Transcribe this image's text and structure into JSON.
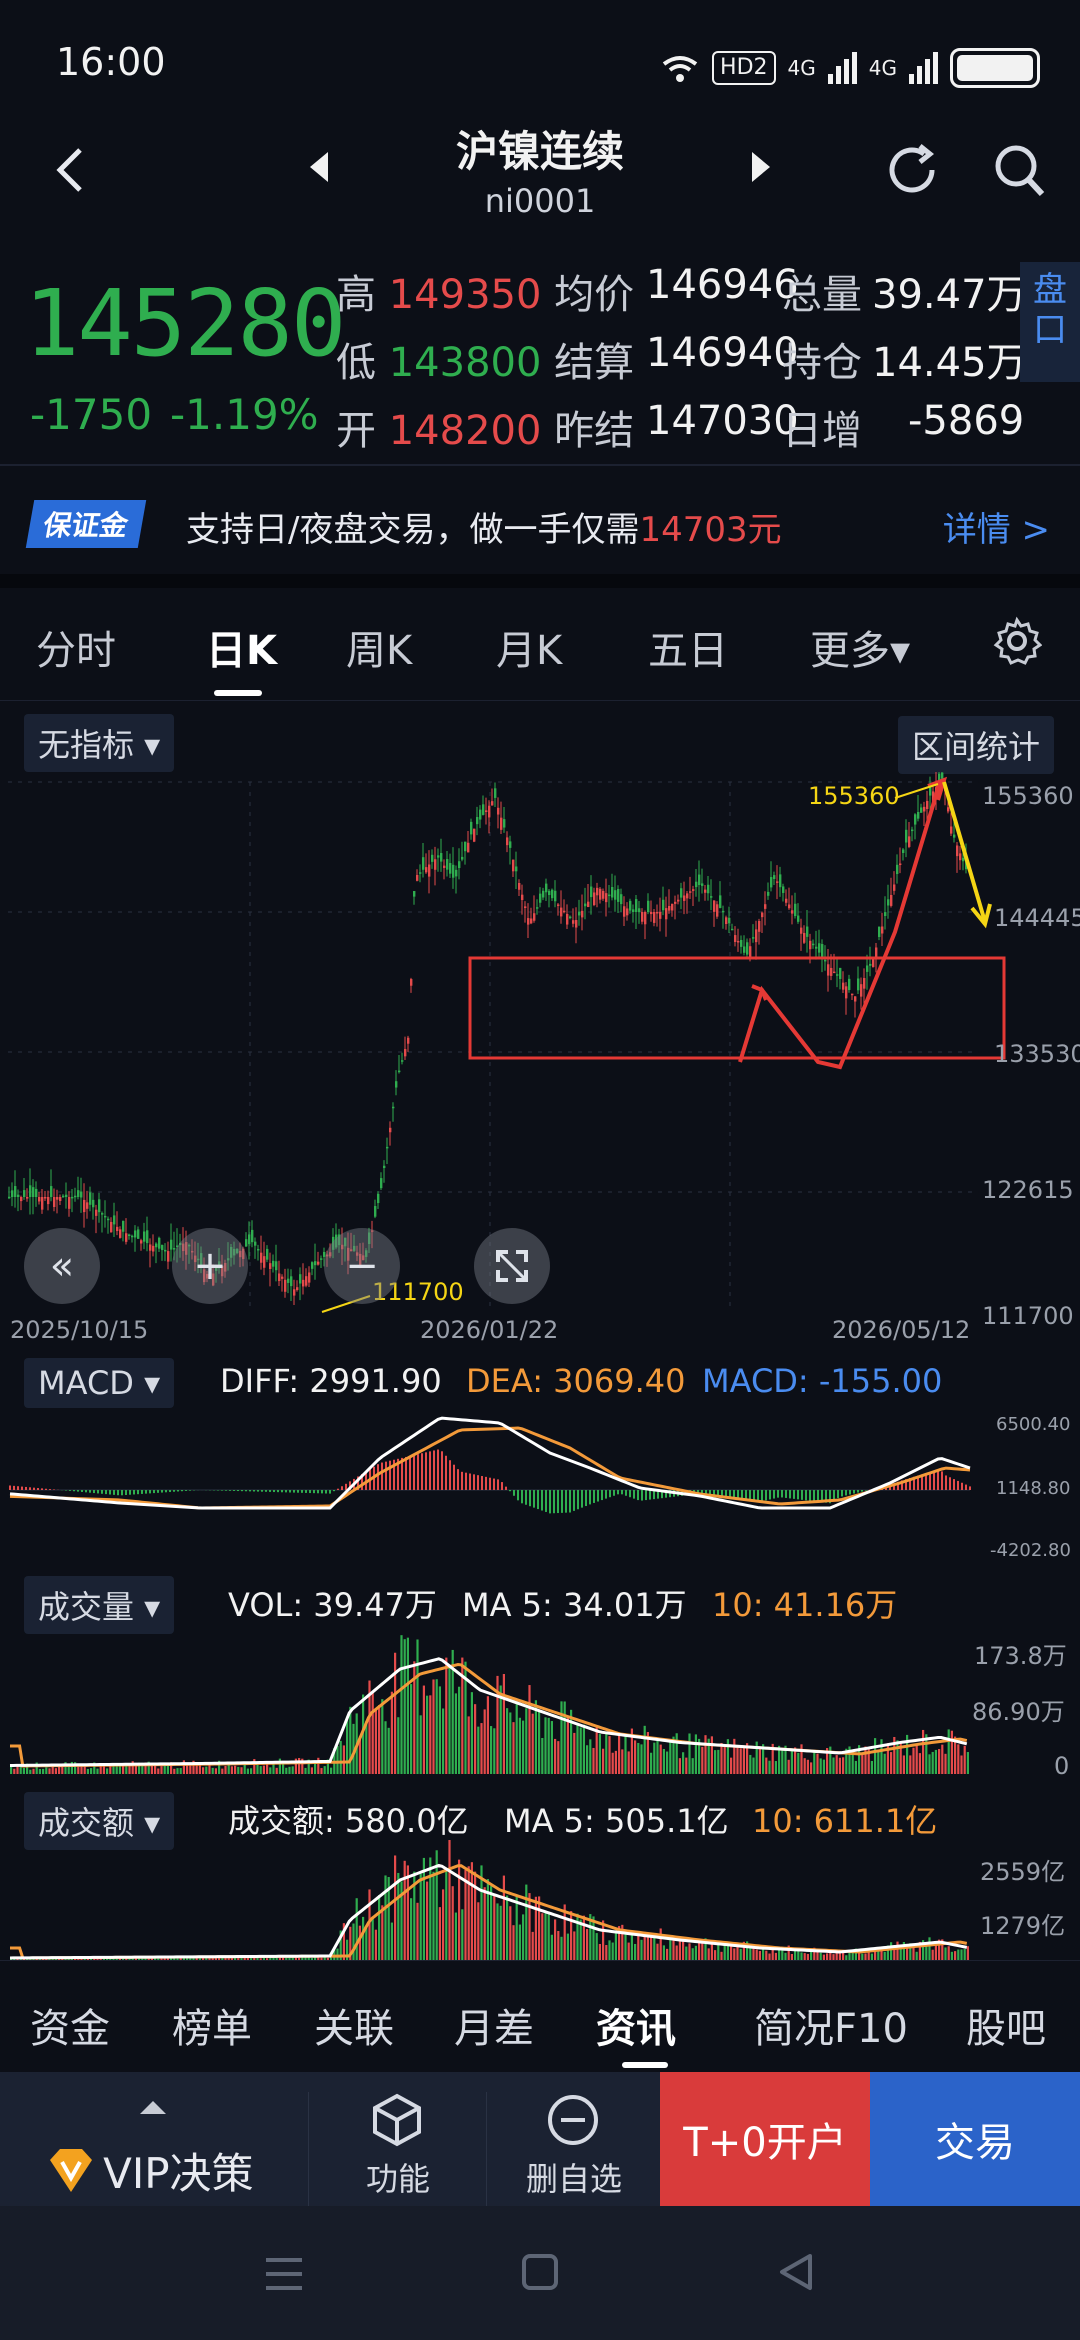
{
  "status": {
    "time": "16:00",
    "hd": "HD2",
    "net1": "4G",
    "net2": "4G"
  },
  "header": {
    "title": "沪镍连续",
    "code": "ni0001"
  },
  "quote": {
    "last": "145280",
    "change": "-1750",
    "change_pct": "-1.19%",
    "rows": [
      {
        "l1": "高",
        "v1": "149350",
        "l2": "均价",
        "v2": "146946",
        "l3": "总量",
        "v3": "39.47万"
      },
      {
        "l1": "低",
        "v1": "143800",
        "l2": "结算",
        "v2": "146940",
        "l3": "持仓",
        "v3": "14.45万"
      },
      {
        "l1": "开",
        "v1": "148200",
        "l2": "昨结",
        "v2": "147030",
        "l3": "日增",
        "v3": "-5869"
      }
    ],
    "panel_button": "盘口"
  },
  "banner": {
    "badge": "保证金",
    "text": "支持日/夜盘交易，做一手仅需",
    "amount": "14703元",
    "detail": "详情 >"
  },
  "tabs": [
    "分时",
    "日K",
    "周K",
    "月K",
    "五日",
    "更多▾"
  ],
  "chart": {
    "indicator_selector": "无指标 ▾",
    "range_stats": "区间统计",
    "y_labels": [
      "155360",
      "144445",
      "133530",
      "122615",
      "111700"
    ],
    "x_labels": [
      "2025/10/15",
      "2026/01/22",
      "2026/05/12"
    ],
    "high_label": "155360",
    "low_label": "111700",
    "colors": {
      "up": "#e54b4b",
      "down": "#2fae4f",
      "annotation": "#f5d515",
      "box": "#e53935"
    }
  },
  "macd": {
    "selector": "MACD ▾",
    "diff": "DIFF: 2991.90",
    "dea": "DEA: 3069.40",
    "macd": "MACD: -155.00",
    "y_labels": [
      "6500.40",
      "1148.80",
      "-4202.80"
    ]
  },
  "volume": {
    "selector": "成交量 ▾",
    "vol": "VOL: 39.47万",
    "ma5": "MA 5: 34.01万",
    "ma10": "10: 41.16万",
    "y_labels": [
      "173.8万",
      "86.90万",
      "0"
    ]
  },
  "amount": {
    "selector": "成交额 ▾",
    "amt": "成交额: 580.0亿",
    "ma5": "MA 5: 505.1亿",
    "ma10": "10: 611.1亿",
    "y_labels": [
      "2559亿",
      "1279亿"
    ]
  },
  "bottom_tabs": [
    "资金",
    "榜单",
    "关联",
    "月差",
    "资讯",
    "简况F10",
    "股吧"
  ],
  "actions": {
    "vip": "VIP决策",
    "func": "功能",
    "remove": "删自选",
    "open": "T+0开户",
    "trade": "交易"
  }
}
